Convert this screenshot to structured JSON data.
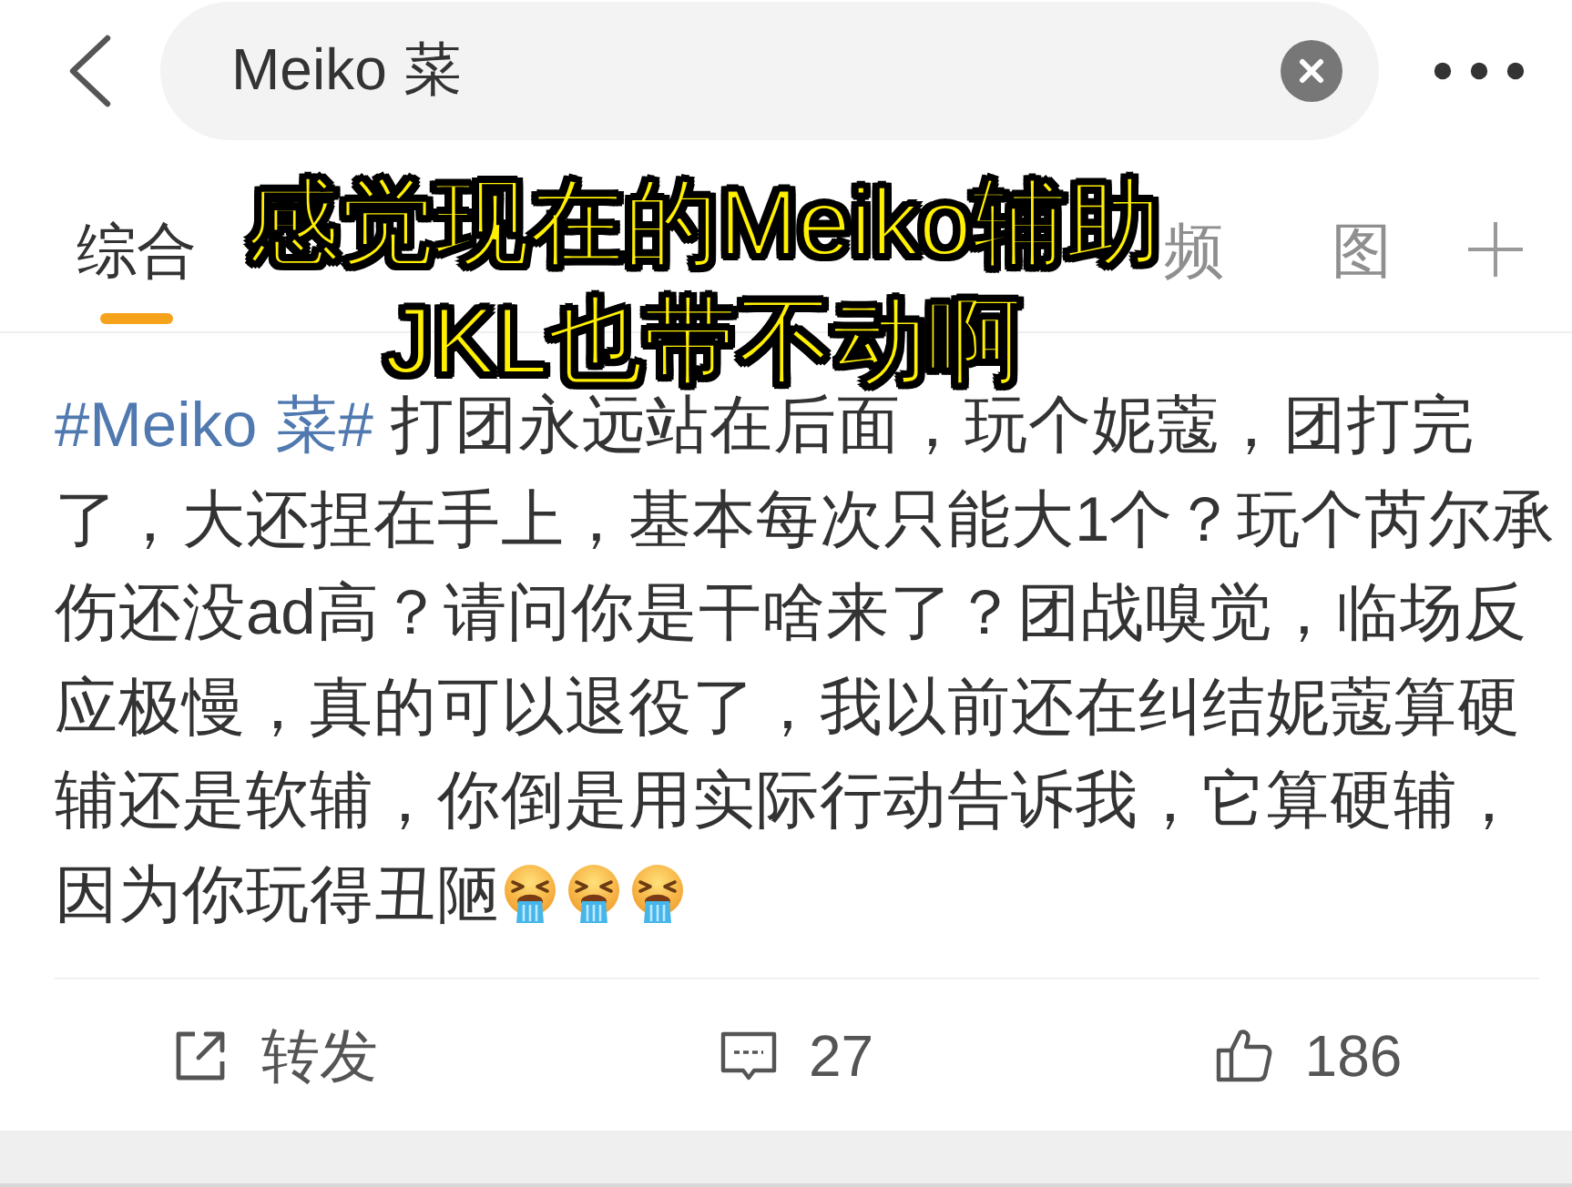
{
  "search": {
    "value": "Meiko 菜"
  },
  "tabs": [
    {
      "label": "综合",
      "selected": true
    },
    {
      "label": "频",
      "selected": false
    },
    {
      "label": "图",
      "selected": false
    }
  ],
  "caption": {
    "lines": [
      "感觉现在的Meiko辅助",
      "JKL也带不动啊"
    ]
  },
  "post": {
    "hashtag": "#Meiko 菜#",
    "text": "打团永远站在后面，玩个妮蔻，团打完了，大还捏在手上，基本每次只能大1个？玩个芮尔承伤还没ad高？请问你是干啥来了？团战嗅觉，临场反应极慢，真的可以退役了，我以前还在纠结妮蔻算硬辅还是软辅，你倒是用实际行动告诉我，它算硬辅，因为你玩得丑陋"
  },
  "actions": [
    {
      "kind": "repost",
      "label": "转发"
    },
    {
      "kind": "comment",
      "label": "27"
    },
    {
      "kind": "like",
      "label": "186"
    }
  ]
}
